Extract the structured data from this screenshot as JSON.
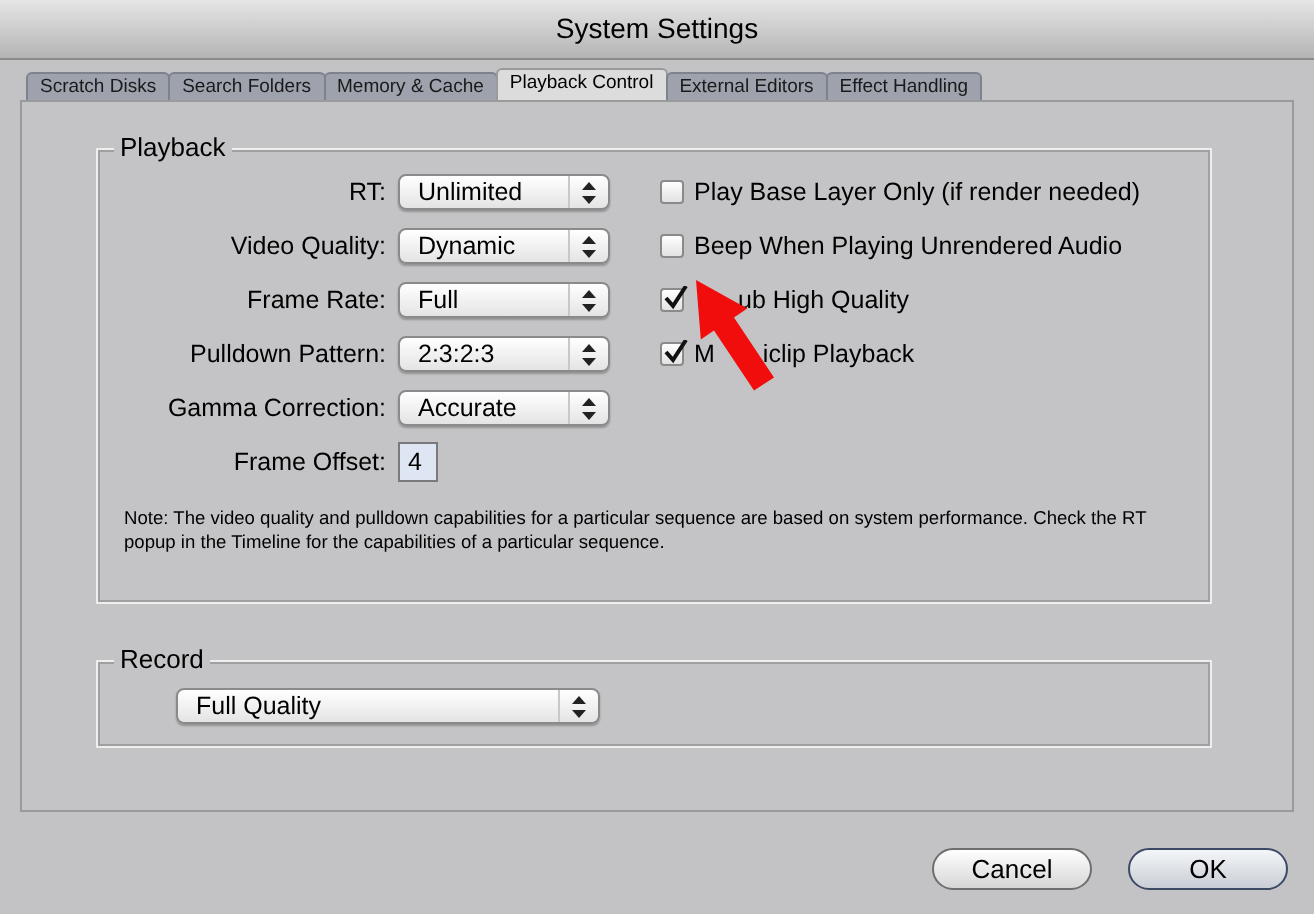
{
  "window": {
    "title": "System Settings"
  },
  "tabs": [
    {
      "label": "Scratch Disks",
      "selected": false
    },
    {
      "label": "Search Folders",
      "selected": false
    },
    {
      "label": "Memory & Cache",
      "selected": false
    },
    {
      "label": "Playback Control",
      "selected": true
    },
    {
      "label": "External Editors",
      "selected": false
    },
    {
      "label": "Effect Handling",
      "selected": false
    }
  ],
  "playback": {
    "title": "Playback",
    "settings": [
      {
        "kind": "popup",
        "label": "RT:",
        "value": "Unlimited"
      },
      {
        "kind": "popup",
        "label": "Video Quality:",
        "value": "Dynamic"
      },
      {
        "kind": "popup",
        "label": "Frame Rate:",
        "value": "Full"
      },
      {
        "kind": "popup",
        "label": "Pulldown Pattern:",
        "value": "2:3:2:3"
      },
      {
        "kind": "popup",
        "label": "Gamma Correction:",
        "value": "Accurate"
      },
      {
        "kind": "field",
        "label": "Frame Offset:",
        "value": "4"
      }
    ],
    "options": [
      {
        "label_parts": [
          "Play Base Layer Only (if render needed)"
        ],
        "lead_hidden": false,
        "checked": false
      },
      {
        "label_parts": [
          "Beep When Playing Unrendered Audio"
        ],
        "lead_hidden": false,
        "checked": false
      },
      {
        "label_parts": [
          "ub High Quality"
        ],
        "lead_hidden": true,
        "checked": true
      },
      {
        "label_parts": [
          "M",
          "iclip Playback"
        ],
        "lead_hidden": false,
        "checked": true
      }
    ],
    "note": "Note: The video quality and pulldown capabilities for a particular sequence are based on system performance. Check the RT popup in the Timeline for the capabilities of a particular sequence."
  },
  "record": {
    "title": "Record",
    "value": "Full Quality"
  },
  "buttons": [
    {
      "label": "Cancel",
      "default": false
    },
    {
      "label": "OK",
      "default": true
    }
  ]
}
